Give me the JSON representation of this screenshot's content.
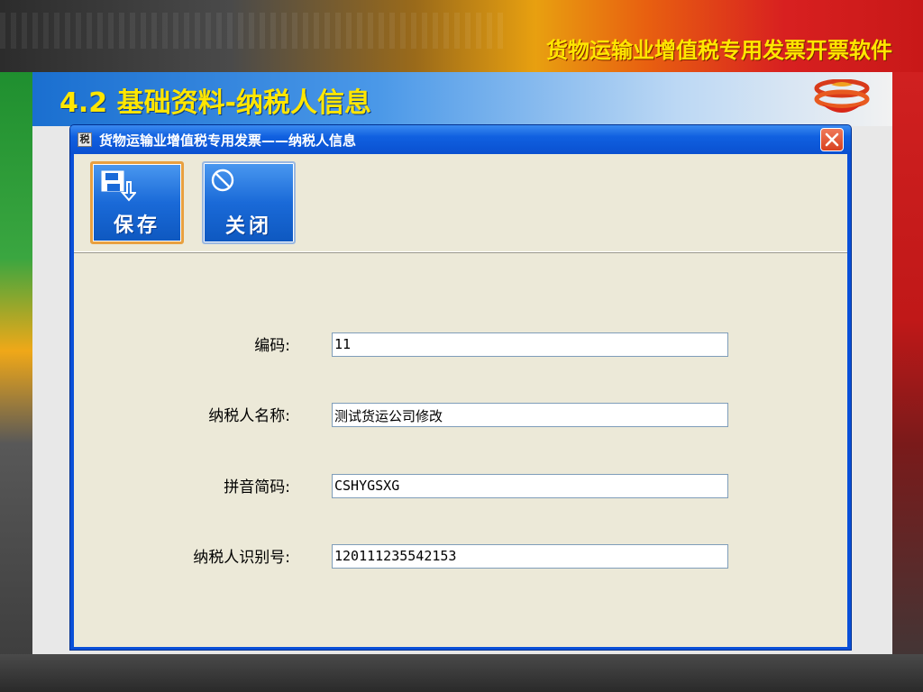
{
  "slide": {
    "header_title": "货物运输业增值税专用发票开票软件",
    "section_title": "4.2 基础资料-纳税人信息"
  },
  "window": {
    "title": "货物运输业增值税专用发票——纳税人信息",
    "app_icon_glyph": "税",
    "close_icon": "close-icon"
  },
  "toolbar": {
    "save_label": "保存",
    "save_icon": "floppy-save-icon",
    "close_label": "关闭",
    "close_icon": "no-entry-icon"
  },
  "form": {
    "fields": [
      {
        "label": "编码:",
        "value": "11"
      },
      {
        "label": "纳税人名称:",
        "value": "测试货运公司修改"
      },
      {
        "label": "拼音简码:",
        "value": "CSHYGSXG"
      },
      {
        "label": "纳税人识别号:",
        "value": "120111235542153"
      }
    ]
  },
  "colors": {
    "header_text": "#ffe600",
    "titlebar": "#0a50d8",
    "client_bg": "#ece9d8",
    "button_blue": "#1a6ad8",
    "save_focus_border": "#e8a040"
  }
}
